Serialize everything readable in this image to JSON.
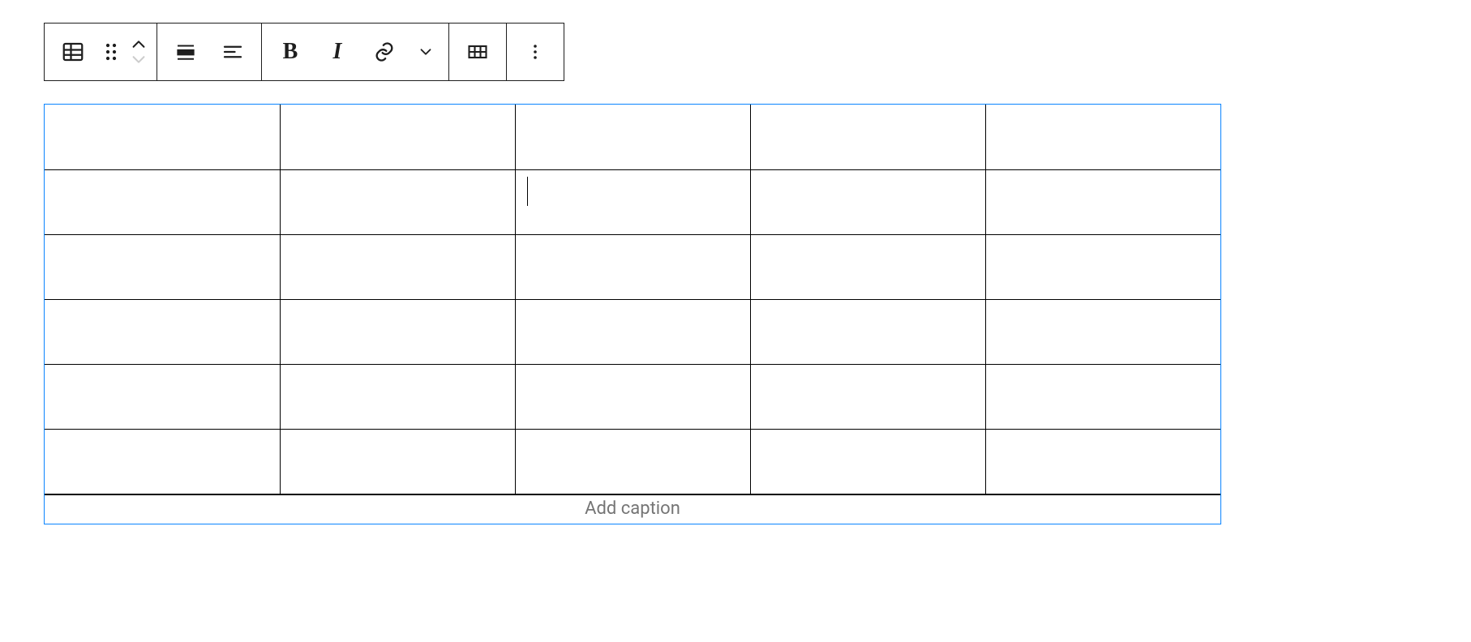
{
  "toolbar": {
    "block_type": "Table",
    "drag": "Drag",
    "move_up": "Move up",
    "move_down": "Move down",
    "align": "Change alignment",
    "text_align": "Change text alignment",
    "bold": "Bold",
    "italic": "Italic",
    "link": "Link",
    "more_rich": "More rich text controls",
    "edit_table": "Edit table",
    "more_options": "More options"
  },
  "table": {
    "rows": 6,
    "cols": 5,
    "active_cell": {
      "row": 1,
      "col": 2
    },
    "cells": [
      [
        "",
        "",
        "",
        "",
        ""
      ],
      [
        "",
        "",
        "",
        "",
        ""
      ],
      [
        "",
        "",
        "",
        "",
        ""
      ],
      [
        "",
        "",
        "",
        "",
        ""
      ],
      [
        "",
        "",
        "",
        "",
        ""
      ],
      [
        "",
        "",
        "",
        "",
        ""
      ]
    ],
    "caption_placeholder": "Add caption",
    "caption_value": ""
  }
}
